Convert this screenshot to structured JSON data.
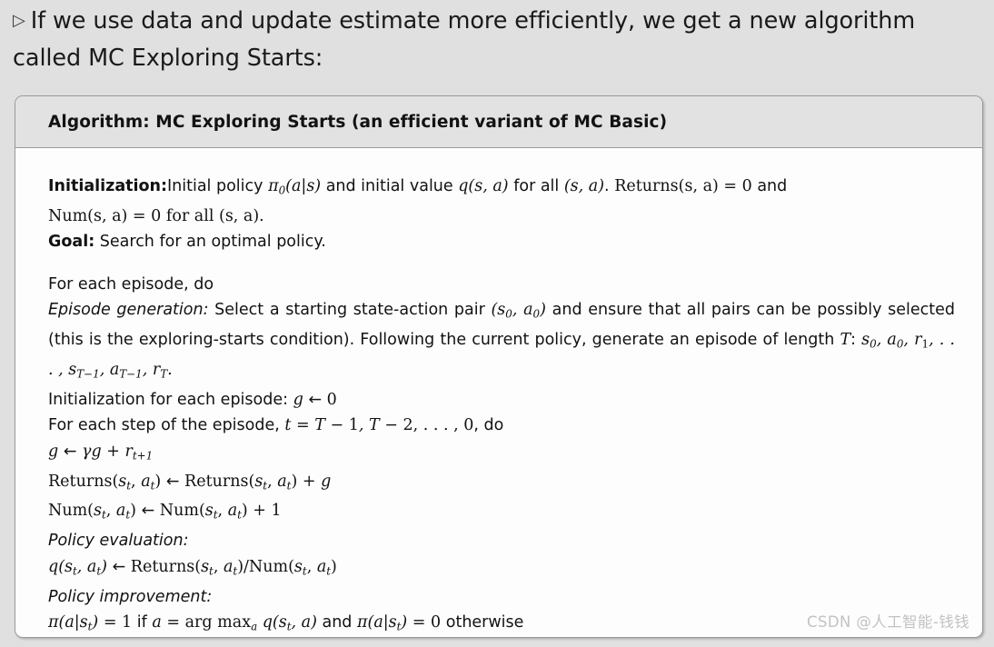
{
  "slide": {
    "background_color": "#e0e0e0",
    "bullet_glyph": "▷",
    "intro_text": "If we use data and update estimate more efficiently, we get a new algorithm called MC Exploring Starts:"
  },
  "algorithm_box": {
    "header_title": "Algorithm: MC Exploring Starts (an efficient variant of MC Basic)",
    "header_bg_color": "#e2e2e2",
    "body_bg_color": "#fdfdfd",
    "border_color": "#9a9a9a",
    "initialization": {
      "label": "Initialization:",
      "line1_a": "Initial policy ",
      "pi0": "π",
      "pi0_sub": "0",
      "pi0_args": "(a|s)",
      "line1_b": " and initial value ",
      "q_args": "q(s, a)",
      "line1_c": " for all ",
      "sa_pair": "(s, a)",
      "line1_d": ". ",
      "returns_init": "Returns(s, a) = 0",
      "line1_e": " and",
      "line2": "Num(s, a) = 0 for all (s, a)."
    },
    "goal": {
      "label": "Goal:",
      "text": "Search for an optimal policy."
    },
    "loop_outer": "For each episode, do",
    "episode_generation": {
      "label": "Episode generation:",
      "text_a": "Select a starting state-action pair ",
      "pair": "(s",
      "pair_sub0": "0",
      "pair_mid": ", a",
      "pair_sub1": "0",
      "pair_end": ")",
      "text_b": " and ensure that all pairs can be possibly selected (this is the exploring-starts condition). Following the current policy, generate an episode of length ",
      "T": "T",
      "colon": ": ",
      "sequence": "s₀, a₀, r₁, . . . , s_{T−1}, a_{T−1}, r_T."
    },
    "episode_init": {
      "label": "Initialization for each episode:",
      "assign": "g ← 0"
    },
    "loop_inner": {
      "prefix": "For each step of the episode, ",
      "range": "t = T − 1, T − 2, . . . , 0",
      "suffix": ", do"
    },
    "steps": {
      "g_update": "g ← γg + r_{t+1}",
      "returns_update": "Returns(s_t, a_t) ← Returns(s_t, a_t) + g",
      "num_update": "Num(s_t, a_t) ← Num(s_t, a_t) + 1",
      "policy_evaluation_label": "Policy evaluation:",
      "q_update": "q(s_t, a_t) ← Returns(s_t, a_t)/Num(s_t, a_t)",
      "policy_improvement_label": "Policy improvement:",
      "pi_update": "π(a|s_t) = 1 if a = arg max_a q(s_t, a) and π(a|s_t) = 0 otherwise"
    }
  },
  "watermark": {
    "text": "CSDN @人工智能-钱钱",
    "color": "#c2c2c2"
  }
}
